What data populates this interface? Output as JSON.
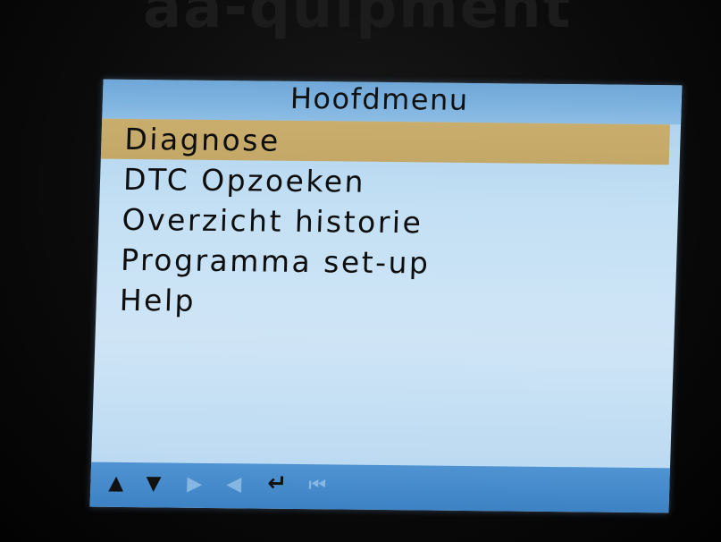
{
  "screen": {
    "title": "Hoofdmenu",
    "menu_items": [
      {
        "label": "Diagnose",
        "selected": true
      },
      {
        "label": "DTC Opzoeken",
        "selected": false
      },
      {
        "label": "Overzicht historie",
        "selected": false
      },
      {
        "label": "Programma set-up",
        "selected": false
      },
      {
        "label": "Help",
        "selected": false
      }
    ]
  },
  "nav_bar": {
    "icons": [
      {
        "name": "up-arrow-icon",
        "glyph": "▲",
        "enabled": true
      },
      {
        "name": "down-arrow-icon",
        "glyph": "▼",
        "enabled": true
      },
      {
        "name": "right-arrow-icon",
        "glyph": "▶",
        "enabled": false
      },
      {
        "name": "left-arrow-icon",
        "glyph": "◀",
        "enabled": false
      },
      {
        "name": "enter-icon",
        "glyph": "↵",
        "enabled": true
      },
      {
        "name": "back-to-start-icon",
        "glyph": "⏮",
        "enabled": false
      }
    ]
  },
  "colors": {
    "screen_bg": "#c4e0f4",
    "title_bar": "#7fb4e0",
    "selection": "#c9ad6c",
    "bottom_bar": "#3d82c4"
  }
}
